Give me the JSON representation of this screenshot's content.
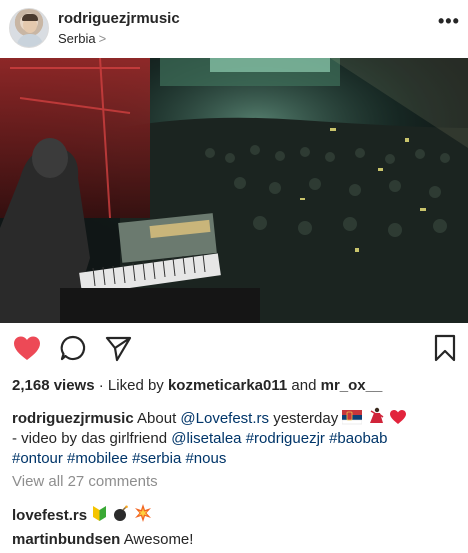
{
  "post": {
    "username": "rodriguezjrmusic",
    "location": "Serbia",
    "location_chevron": ">",
    "more_icon": "more-horizontal-icon",
    "more_label": "•••"
  },
  "actions": {
    "like_icon": "heart-filled-icon",
    "comment_icon": "comment-bubble-icon",
    "share_icon": "paper-plane-icon",
    "save_icon": "bookmark-icon",
    "liked_color": "#ed4956"
  },
  "stats": {
    "views": "2,168 views",
    "separator": "·",
    "liked_by_prefix": "Liked by",
    "liked_by_user": "kozmeticarka011",
    "and": "and",
    "liked_by_user2": "mr_ox__"
  },
  "caption": {
    "username": "rodriguezjrmusic",
    "text_1": "About",
    "mention_1": "@Lovefest.rs",
    "text_2": "yesterday",
    "text_3": "- video by das girlfriend",
    "mention_2": "@lisetalea",
    "hashtags": [
      "#rodriguezjr",
      "#baobab",
      "#ontour",
      "#mobilee",
      "#serbia",
      "#nous"
    ]
  },
  "view_all_comments": "View all 27 comments",
  "comments": [
    {
      "username": "lovefest.rs",
      "text": ""
    },
    {
      "username": "martinbundsen",
      "text": "Awesome!"
    }
  ]
}
